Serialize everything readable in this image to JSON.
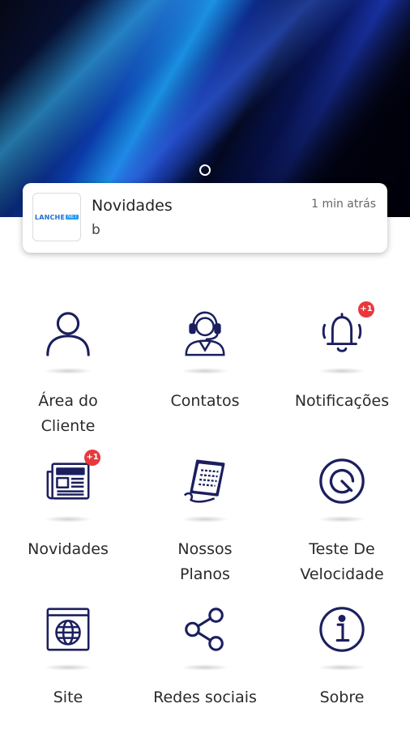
{
  "banner": {
    "carousel_indicator": "carousel-dot"
  },
  "notification": {
    "title": "Novidades",
    "body": "b",
    "time": "1 min atrás",
    "logo_text": "LANCHE",
    "logo_tag": "NET"
  },
  "menu": {
    "items": [
      {
        "label_line1": "Área do",
        "label_line2": "Cliente",
        "icon": "user-icon"
      },
      {
        "label_line1": "Contatos",
        "label_line2": "",
        "icon": "headset-agent-icon"
      },
      {
        "label_line1": "Notificações",
        "label_line2": "",
        "icon": "bell-icon",
        "badge": "+1"
      },
      {
        "label_line1": "Novidades",
        "label_line2": "",
        "icon": "newspaper-icon",
        "badge": "+1"
      },
      {
        "label_line1": "Nossos",
        "label_line2": "Planos",
        "icon": "plans-document-icon"
      },
      {
        "label_line1": "Teste De",
        "label_line2": "Velocidade",
        "icon": "speedometer-icon"
      },
      {
        "label_line1": "Site",
        "label_line2": "",
        "icon": "web-globe-icon"
      },
      {
        "label_line1": "Redes sociais",
        "label_line2": "",
        "icon": "share-icon"
      },
      {
        "label_line1": "Sobre",
        "label_line2": "",
        "icon": "info-icon"
      }
    ]
  },
  "colors": {
    "icon": "#1b1f5e",
    "badge": "#e8383d"
  }
}
